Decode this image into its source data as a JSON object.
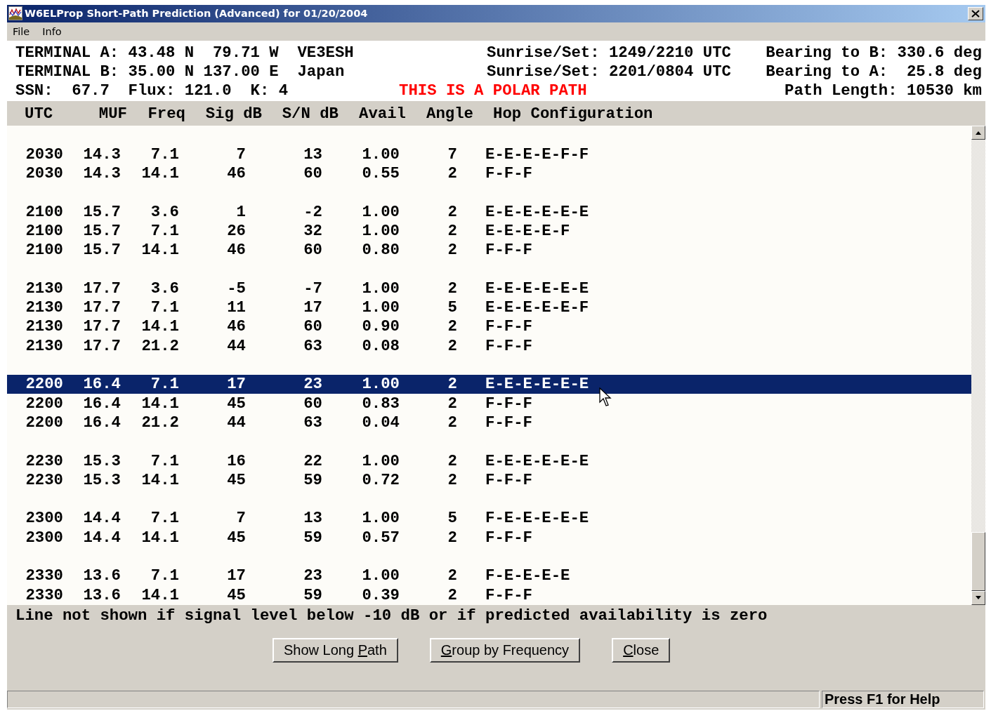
{
  "window": {
    "title": "W6ELProp Short-Path Prediction (Advanced) for 01/20/2004"
  },
  "menu": [
    "File",
    "Info"
  ],
  "info_lines": [
    {
      "left": "TERMINAL A: 43.48 N  79.71 W  VE3ESH",
      "middle": "Sunrise/Set: 1249/2210 UTC",
      "middle_warning": false,
      "right": "Bearing to B: 330.6 deg"
    },
    {
      "left": "TERMINAL B: 35.00 N 137.00 E  Japan",
      "middle": "Sunrise/Set: 2201/0804 UTC",
      "middle_warning": false,
      "right": "Bearing to A:  25.8 deg"
    },
    {
      "left": "SSN:  67.7  Flux: 121.0  K: 4",
      "middle": "THIS IS A POLAR PATH",
      "middle_warning": true,
      "right": "Path Length: 10530 km"
    }
  ],
  "table": {
    "columns": [
      "UTC",
      "MUF",
      "Freq",
      "Sig dB",
      "S/N dB",
      "Avail",
      "Angle",
      "Hop Configuration"
    ],
    "groups": [
      {
        "rows": [
          {
            "cells": [
              "2030",
              "14.3",
              "7.1",
              "7",
              "13",
              "1.00",
              "7",
              "E-E-E-E-F-F"
            ],
            "selected": false
          },
          {
            "cells": [
              "2030",
              "14.3",
              "14.1",
              "46",
              "60",
              "0.55",
              "2",
              "F-F-F"
            ],
            "selected": false
          }
        ]
      },
      {
        "rows": [
          {
            "cells": [
              "2100",
              "15.7",
              "3.6",
              "1",
              "-2",
              "1.00",
              "2",
              "E-E-E-E-E-E"
            ],
            "selected": false
          },
          {
            "cells": [
              "2100",
              "15.7",
              "7.1",
              "26",
              "32",
              "1.00",
              "2",
              "E-E-E-E-F"
            ],
            "selected": false
          },
          {
            "cells": [
              "2100",
              "15.7",
              "14.1",
              "46",
              "60",
              "0.80",
              "2",
              "F-F-F"
            ],
            "selected": false
          }
        ]
      },
      {
        "rows": [
          {
            "cells": [
              "2130",
              "17.7",
              "3.6",
              "-5",
              "-7",
              "1.00",
              "2",
              "E-E-E-E-E-E"
            ],
            "selected": false
          },
          {
            "cells": [
              "2130",
              "17.7",
              "7.1",
              "11",
              "17",
              "1.00",
              "5",
              "E-E-E-E-E-F"
            ],
            "selected": false
          },
          {
            "cells": [
              "2130",
              "17.7",
              "14.1",
              "46",
              "60",
              "0.90",
              "2",
              "F-F-F"
            ],
            "selected": false
          },
          {
            "cells": [
              "2130",
              "17.7",
              "21.2",
              "44",
              "63",
              "0.08",
              "2",
              "F-F-F"
            ],
            "selected": false
          }
        ]
      },
      {
        "rows": [
          {
            "cells": [
              "2200",
              "16.4",
              "7.1",
              "17",
              "23",
              "1.00",
              "2",
              "E-E-E-E-E-E"
            ],
            "selected": true
          },
          {
            "cells": [
              "2200",
              "16.4",
              "14.1",
              "45",
              "60",
              "0.83",
              "2",
              "F-F-F"
            ],
            "selected": false
          },
          {
            "cells": [
              "2200",
              "16.4",
              "21.2",
              "44",
              "63",
              "0.04",
              "2",
              "F-F-F"
            ],
            "selected": false
          }
        ]
      },
      {
        "rows": [
          {
            "cells": [
              "2230",
              "15.3",
              "7.1",
              "16",
              "22",
              "1.00",
              "2",
              "E-E-E-E-E-E"
            ],
            "selected": false
          },
          {
            "cells": [
              "2230",
              "15.3",
              "14.1",
              "45",
              "59",
              "0.72",
              "2",
              "F-F-F"
            ],
            "selected": false
          }
        ]
      },
      {
        "rows": [
          {
            "cells": [
              "2300",
              "14.4",
              "7.1",
              "7",
              "13",
              "1.00",
              "5",
              "F-E-E-E-E-E"
            ],
            "selected": false
          },
          {
            "cells": [
              "2300",
              "14.4",
              "14.1",
              "45",
              "59",
              "0.57",
              "2",
              "F-F-F"
            ],
            "selected": false
          }
        ]
      },
      {
        "rows": [
          {
            "cells": [
              "2330",
              "13.6",
              "7.1",
              "17",
              "23",
              "1.00",
              "2",
              "F-E-E-E-E"
            ],
            "selected": false
          },
          {
            "cells": [
              "2330",
              "13.6",
              "14.1",
              "45",
              "59",
              "0.39",
              "2",
              "F-F-F"
            ],
            "selected": false
          }
        ]
      }
    ]
  },
  "note": "Line not shown if signal level below -10 dB or if predicted availability is zero",
  "buttons": [
    {
      "before": "Show Long ",
      "access_key": "P",
      "after": "ath"
    },
    {
      "access_key": "G",
      "after": "roup by Frequency"
    },
    {
      "access_key": "C",
      "after": "lose"
    }
  ],
  "status_bar": {
    "hint": "Press F1 for Help"
  }
}
